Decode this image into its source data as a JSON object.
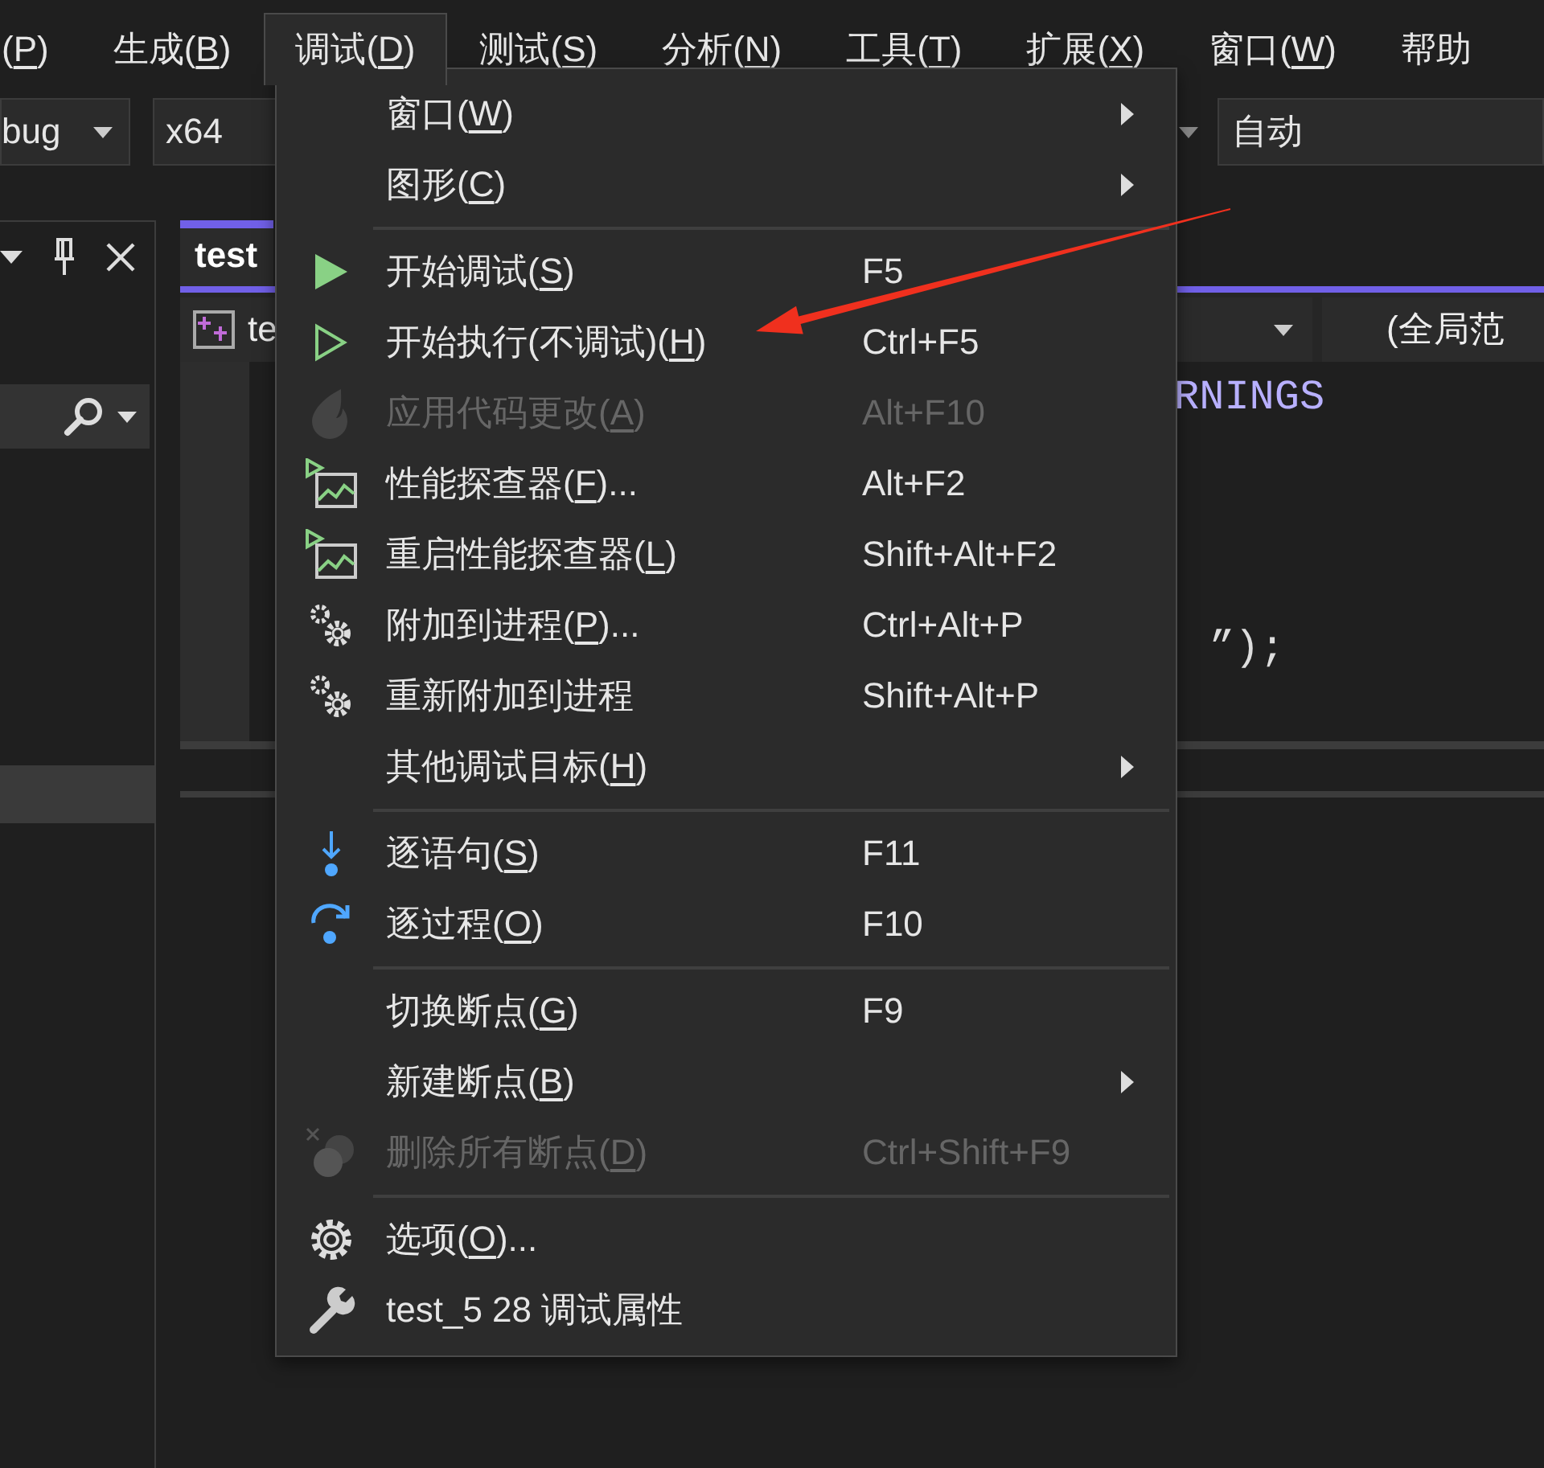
{
  "menu_bar": [
    {
      "text": "(",
      "key": "P",
      "rest": ")",
      "selected": false
    },
    {
      "text": "生成(",
      "key": "B",
      "rest": ")",
      "selected": false
    },
    {
      "text": "调试(",
      "key": "D",
      "rest": ")",
      "selected": true
    },
    {
      "text": "测试(",
      "key": "S",
      "rest": ")",
      "selected": false
    },
    {
      "text": "分析(",
      "key": "N",
      "rest": ")",
      "selected": false
    },
    {
      "text": "工具(",
      "key": "T",
      "rest": ")",
      "selected": false
    },
    {
      "text": "扩展(",
      "key": "X",
      "rest": ")",
      "selected": false
    },
    {
      "text": "窗口(",
      "key": "W",
      "rest": ")",
      "selected": false
    },
    {
      "text": "帮助",
      "selected": false
    }
  ],
  "toolbar": {
    "configuration": "bug",
    "platform": "x64",
    "field": "自动"
  },
  "editor": {
    "tab": "test",
    "file": "te",
    "scope": "(全局范",
    "code_lines": [
      {
        "text": "RNINGS",
        "kind": "macro"
      },
      {
        "text": "”);",
        "kind": "plain"
      }
    ]
  },
  "debug_menu": {
    "groups": [
      [
        {
          "kind": "plain",
          "text": "窗口(",
          "key": "W",
          "rest": ")",
          "disabled": false,
          "submenu": true
        },
        {
          "kind": "plain",
          "text": "图形(",
          "key": "C",
          "rest": ")",
          "disabled": false,
          "submenu": true
        }
      ],
      [
        {
          "kind": "play",
          "text": "开始调试(",
          "key": "S",
          "rest": ")",
          "shortcut": "F5",
          "disabled": false,
          "submenu": false
        },
        {
          "kind": "play-outline",
          "text": "开始执行(不调试)(",
          "key": "H",
          "rest": ")",
          "shortcut": "Ctrl+F5",
          "disabled": false,
          "submenu": false
        },
        {
          "kind": "flame",
          "text": "应用代码更改(",
          "key": "A",
          "rest": ")",
          "shortcut": "Alt+F10",
          "disabled": true,
          "submenu": false
        },
        {
          "kind": "chart",
          "text": "性能探查器(",
          "key": "F",
          "rest": ")...",
          "shortcut": "Alt+F2",
          "disabled": false,
          "submenu": false
        },
        {
          "kind": "chart",
          "text": "重启性能探查器(",
          "key": "L",
          "rest": ")",
          "shortcut": "Shift+Alt+F2",
          "disabled": false,
          "submenu": false
        },
        {
          "kind": "gears",
          "text": "附加到进程(",
          "key": "P",
          "rest": ")...",
          "shortcut": "Ctrl+Alt+P",
          "disabled": false,
          "submenu": false
        },
        {
          "kind": "gears",
          "text": "重新附加到进程",
          "shortcut": "Shift+Alt+P",
          "disabled": false,
          "submenu": false
        },
        {
          "kind": "plain",
          "text": "其他调试目标(",
          "key": "H",
          "rest": ")",
          "disabled": false,
          "submenu": true
        }
      ],
      [
        {
          "kind": "step-into",
          "text": "逐语句(",
          "key": "S",
          "rest": ")",
          "shortcut": "F11",
          "disabled": false,
          "submenu": false
        },
        {
          "kind": "step-over",
          "text": "逐过程(",
          "key": "O",
          "rest": ")",
          "shortcut": "F10",
          "disabled": false,
          "submenu": false
        }
      ],
      [
        {
          "kind": "plain",
          "text": "切换断点(",
          "key": "G",
          "rest": ")",
          "shortcut": "F9",
          "disabled": false,
          "submenu": false
        },
        {
          "kind": "plain",
          "text": "新建断点(",
          "key": "B",
          "rest": ")",
          "disabled": false,
          "submenu": true
        },
        {
          "kind": "delete-breakpoints",
          "text": "删除所有断点(",
          "key": "D",
          "rest": ")",
          "shortcut": "Ctrl+Shift+F9",
          "disabled": true,
          "submenu": false
        }
      ],
      [
        {
          "kind": "options",
          "text": "选项(",
          "key": "O",
          "rest": ")...",
          "disabled": false,
          "submenu": false
        },
        {
          "kind": "properties",
          "text": "test_5 28 调试属性",
          "disabled": false,
          "submenu": false
        }
      ]
    ]
  }
}
